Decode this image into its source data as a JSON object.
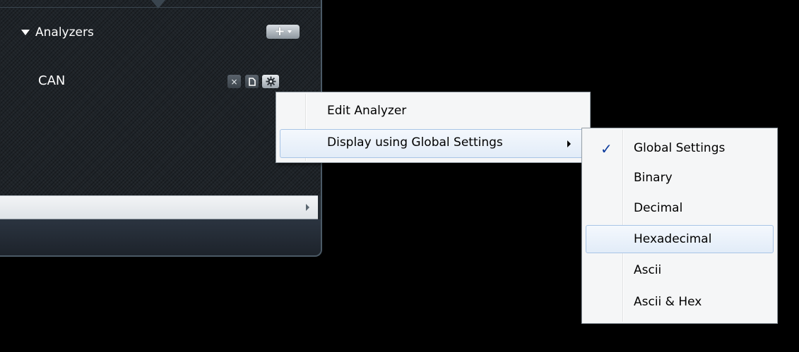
{
  "panel": {
    "section_title": "Analyzers",
    "add_button_label": "+",
    "analyzer": {
      "name": "CAN",
      "close_label": "×"
    }
  },
  "context_menu": {
    "items": [
      {
        "label": "Edit Analyzer",
        "has_submenu": false,
        "highlighted": false
      },
      {
        "label": "Display using Global Settings",
        "has_submenu": true,
        "highlighted": true
      }
    ]
  },
  "display_submenu": {
    "items": [
      {
        "label": "Global Settings",
        "checked": true,
        "highlighted": false
      },
      {
        "label": "Binary",
        "checked": false,
        "highlighted": false
      },
      {
        "label": "Decimal",
        "checked": false,
        "highlighted": false
      },
      {
        "label": "Hexadecimal",
        "checked": false,
        "highlighted": true
      },
      {
        "label": "Ascii",
        "checked": false,
        "highlighted": false
      },
      {
        "label": "Ascii & Hex",
        "checked": false,
        "highlighted": false
      }
    ]
  },
  "colors": {
    "background": "#000000",
    "panel": "#1e2328",
    "menu_background": "#f5f6f7",
    "menu_highlight_border": "#a8c4e6",
    "checkmark": "#0b3a9c"
  },
  "icons": {
    "section_toggle": "triangle-down-icon",
    "add": "plus-icon",
    "close": "close-icon",
    "copy": "copy-icon",
    "settings": "gear-icon",
    "submenu": "chevron-right-icon",
    "check": "checkmark-icon",
    "scroll_right": "arrow-right-icon"
  }
}
